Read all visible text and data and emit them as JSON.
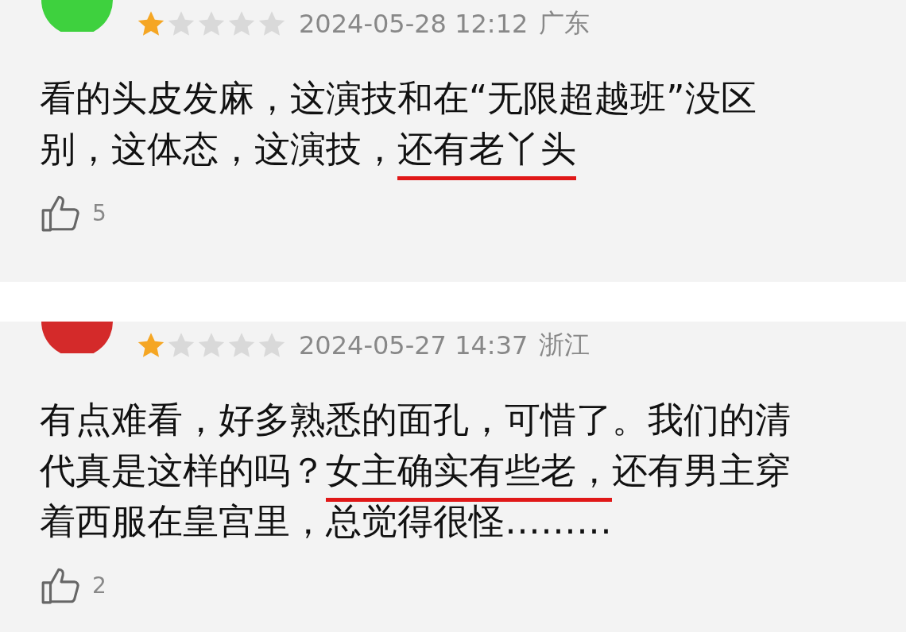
{
  "comments": [
    {
      "color": "#3ed13e",
      "stars": 1,
      "date": "2024-05-28 12:12",
      "region": "广东",
      "segments": [
        {
          "text": "看的头皮发麻，这演技和在“无限超越班”没区别，这体态，这演技，",
          "underlined": false
        },
        {
          "text": "还有老丫头",
          "underlined": true
        }
      ],
      "likes": "5"
    },
    {
      "color": "#d42a2a",
      "stars": 1,
      "date": "2024-05-27 14:37",
      "region": "浙江",
      "segments": [
        {
          "text": "有点难看，好多熟悉的面孔，可惜了。我们的清代真是这样的吗？",
          "underlined": false
        },
        {
          "text": "女主确实有些老，",
          "underlined": true
        },
        {
          "text": "还有男主穿着西服在皇宫里，总觉得很怪………",
          "underlined": false
        }
      ],
      "likes": "2"
    }
  ]
}
